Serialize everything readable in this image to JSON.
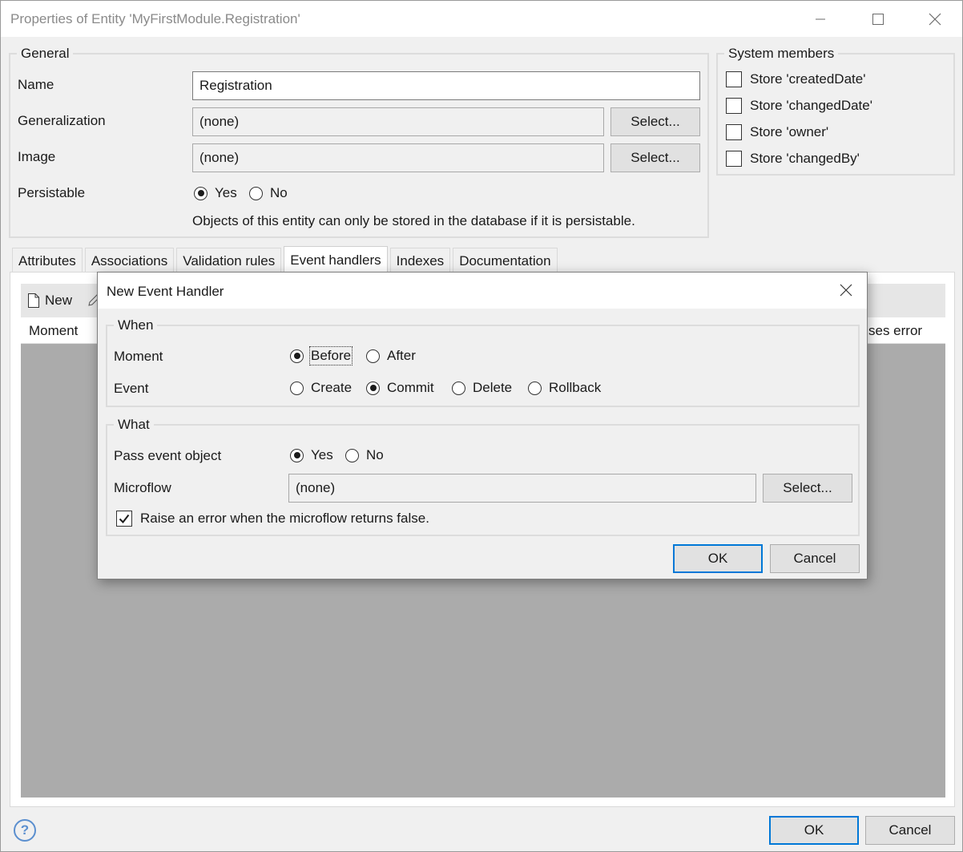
{
  "window": {
    "title": "Properties of Entity 'MyFirstModule.Registration'"
  },
  "general": {
    "legend": "General",
    "name_label": "Name",
    "name_value": "Registration",
    "generalization_label": "Generalization",
    "generalization_value": "(none)",
    "image_label": "Image",
    "image_value": "(none)",
    "select_label": "Select...",
    "persistable_label": "Persistable",
    "persistable_options": [
      "Yes",
      "No"
    ],
    "persistable_selected": "Yes",
    "persistable_note": "Objects of this entity can only be stored in the database if it is persistable."
  },
  "system_members": {
    "legend": "System members",
    "items": [
      {
        "label": "Store 'createdDate'",
        "checked": false
      },
      {
        "label": "Store 'changedDate'",
        "checked": false
      },
      {
        "label": "Store 'owner'",
        "checked": false
      },
      {
        "label": "Store 'changedBy'",
        "checked": false
      }
    ]
  },
  "tabs": [
    {
      "label": "Attributes",
      "active": false
    },
    {
      "label": "Associations",
      "active": false
    },
    {
      "label": "Validation rules",
      "active": false
    },
    {
      "label": "Event handlers",
      "active": true
    },
    {
      "label": "Indexes",
      "active": false
    },
    {
      "label": "Documentation",
      "active": false
    }
  ],
  "event_handlers_panel": {
    "new_label": "New",
    "columns": [
      "Moment",
      "ses error"
    ]
  },
  "footer": {
    "help_icon": "question-circle-icon",
    "ok_label": "OK",
    "cancel_label": "Cancel"
  },
  "dialog": {
    "title": "New Event Handler",
    "when": {
      "legend": "When",
      "moment_label": "Moment",
      "moment_options": [
        "Before",
        "After"
      ],
      "moment_selected": "Before",
      "event_label": "Event",
      "event_options": [
        "Create",
        "Commit",
        "Delete",
        "Rollback"
      ],
      "event_selected": "Commit"
    },
    "what": {
      "legend": "What",
      "pass_event_label": "Pass event object",
      "pass_event_options": [
        "Yes",
        "No"
      ],
      "pass_event_selected": "Yes",
      "microflow_label": "Microflow",
      "microflow_value": "(none)",
      "select_label": "Select...",
      "raise_error_label": "Raise an error when the microflow returns false.",
      "raise_error_checked": true
    },
    "ok_label": "OK",
    "cancel_label": "Cancel"
  },
  "colors": {
    "accent": "#0078d7",
    "grid_empty": "#ababab",
    "help": "#5b8fcf"
  }
}
